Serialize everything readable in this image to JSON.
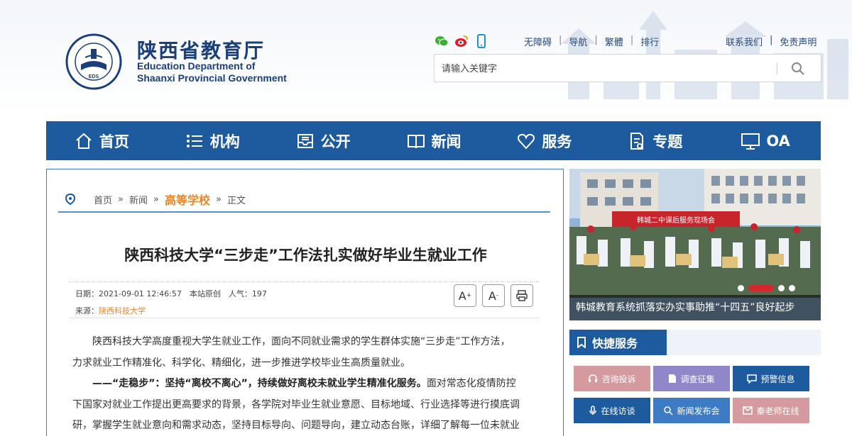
{
  "header": {
    "title_cn": "陕西省教育厅",
    "title_en_line1": "Education Department of",
    "title_en_line2": "Shaanxi Provincial Government",
    "emblem_text_top": "EDUCATION DEPARTMENT OF SHAANXI",
    "emblem_text_bottom": "陕西省教育厅",
    "emblem_center": "EDS",
    "social_icons": [
      "wechat-icon",
      "weibo-icon",
      "mobile-icon"
    ],
    "links_left": [
      "无障碍",
      "导航",
      "繁體",
      "排行"
    ],
    "links_right": [
      "联系我们",
      "免责声明"
    ],
    "search_placeholder": "请输入关键字"
  },
  "nav": {
    "items": [
      {
        "label": "首页",
        "icon": "home-icon"
      },
      {
        "label": "机构",
        "icon": "list-icon"
      },
      {
        "label": "公开",
        "icon": "inbox-icon"
      },
      {
        "label": "新闻",
        "icon": "book-icon"
      },
      {
        "label": "服务",
        "icon": "heart-icon"
      },
      {
        "label": "专题",
        "icon": "document-icon"
      },
      {
        "label": "OA",
        "icon": "monitor-icon"
      }
    ]
  },
  "breadcrumb": {
    "items": [
      "首页",
      "新闻",
      "高等学校",
      "正文"
    ],
    "separator": "»"
  },
  "article": {
    "title": "陕西科技大学“三步走”工作法扎实做好毕业生就业工作",
    "meta_line": "日期：2021-09-01 12:46:57　本站原创　人气：197",
    "source_label": "来源：",
    "source": "陕西科技大学",
    "tools": [
      "A+",
      "A-",
      "print"
    ],
    "para1": "陕西科技大学高度重视大学生就业工作，面向不同就业需求的学生群体实施“三步走”工作方法，",
    "para1b": "力求就业工作精准化、科学化、精细化，进一步推进学校毕业生高质量就业。",
    "para2_bold": "——“走稳步”：坚持“离校不离心”，持续做好离校未就业学生精准化服务。",
    "para2_rest": "面对常态化疫情防控",
    "para3": "下国家对就业工作提出更高要求的背景，各学院对毕业生就业意愿、目标地域、行业选择等进行摸底调",
    "para4": "研，掌握学生就业意向和需求动态，坚持目标导向、问题导向，建立动态台账，详细了解每一位未就业"
  },
  "slideshow": {
    "caption": "韩城教育系统抓落实办实事助推“十四五”良好起步",
    "banner_text": "韩城二中课后服务现场会",
    "dots": 5,
    "active_dot": 2
  },
  "quick_service": {
    "title": "快捷服务",
    "buttons": [
      {
        "label": "咨询投诉",
        "icon": "headset-icon",
        "color": "#d49a9e"
      },
      {
        "label": "调查征集",
        "icon": "file-icon",
        "color": "#8f87c9"
      },
      {
        "label": "预警信息",
        "icon": "chat-icon",
        "color": "#1e5a9e"
      },
      {
        "label": "在线访谈",
        "icon": "mic-icon",
        "color": "#1e5a9e"
      },
      {
        "label": "新闻发布会",
        "icon": "search-icon",
        "color": "#3d7cc4"
      },
      {
        "label": "秦老师在线",
        "icon": "mail-icon",
        "color": "#d49a9e"
      }
    ]
  },
  "colors": {
    "primary": "#1e5a9e",
    "accent": "#e8852b",
    "dot_active": "#d2272c"
  }
}
